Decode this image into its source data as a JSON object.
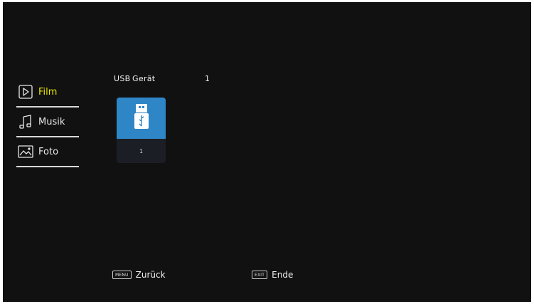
{
  "menu": {
    "items": [
      {
        "label": "Film",
        "icon": "play-icon",
        "active": true
      },
      {
        "label": "Musik",
        "icon": "music-note-icon",
        "active": false
      },
      {
        "label": "Foto",
        "icon": "photo-icon",
        "active": false
      }
    ]
  },
  "device": {
    "type_label": "USB",
    "device_label": "Gerät",
    "count": "1",
    "tile_icon": "usb-drive-icon",
    "tile_label": "1"
  },
  "footer": {
    "back_key": "MENU",
    "back_label": "Zurück",
    "exit_key": "EXIT",
    "exit_label": "Ende"
  },
  "colors": {
    "background": "#111112",
    "active_text": "#e8e600",
    "tile_blue": "#2f86c7"
  }
}
